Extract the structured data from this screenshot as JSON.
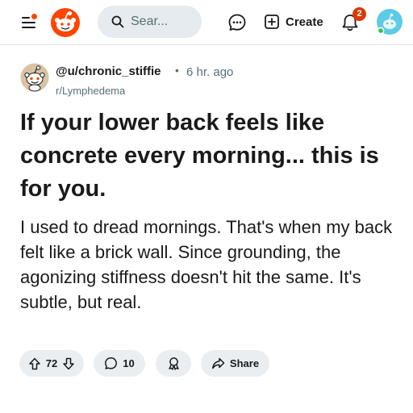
{
  "header": {
    "search_placeholder": "Sear...",
    "create_label": "Create",
    "notification_count": "2",
    "menu_has_unread_dot": true
  },
  "post": {
    "author": "@u/chronic_stiffie",
    "separator": "•",
    "time_ago": "6 hr. ago",
    "subreddit": "r/Lymphedema",
    "title": "If your lower back feels like concrete every morning... this is for you.",
    "body": "I used to dread mornings. That's when my back felt like a brick wall. Since grounding, the agonizing stiffness doesn't hit the same. It's subtle, but real."
  },
  "actions": {
    "upvotes": "72",
    "comments": "10",
    "share_label": "Share"
  },
  "colors": {
    "brand": "#ff4500",
    "badge": "#d93a00",
    "pill_bg": "#eaeef0",
    "muted_text": "#576f76",
    "avatar_teal": "#5ccbe6"
  },
  "icons": {
    "menu": "hamburger-menu-icon",
    "logo": "reddit-snoo-logo",
    "search": "search-icon",
    "chat": "chat-bubble-icon",
    "create": "plus-square-icon",
    "notifications": "bell-icon",
    "upvote": "arrow-up-icon",
    "downvote": "arrow-down-icon",
    "comment": "comment-bubble-icon",
    "award": "award-ribbon-icon",
    "share": "share-arrow-icon"
  }
}
